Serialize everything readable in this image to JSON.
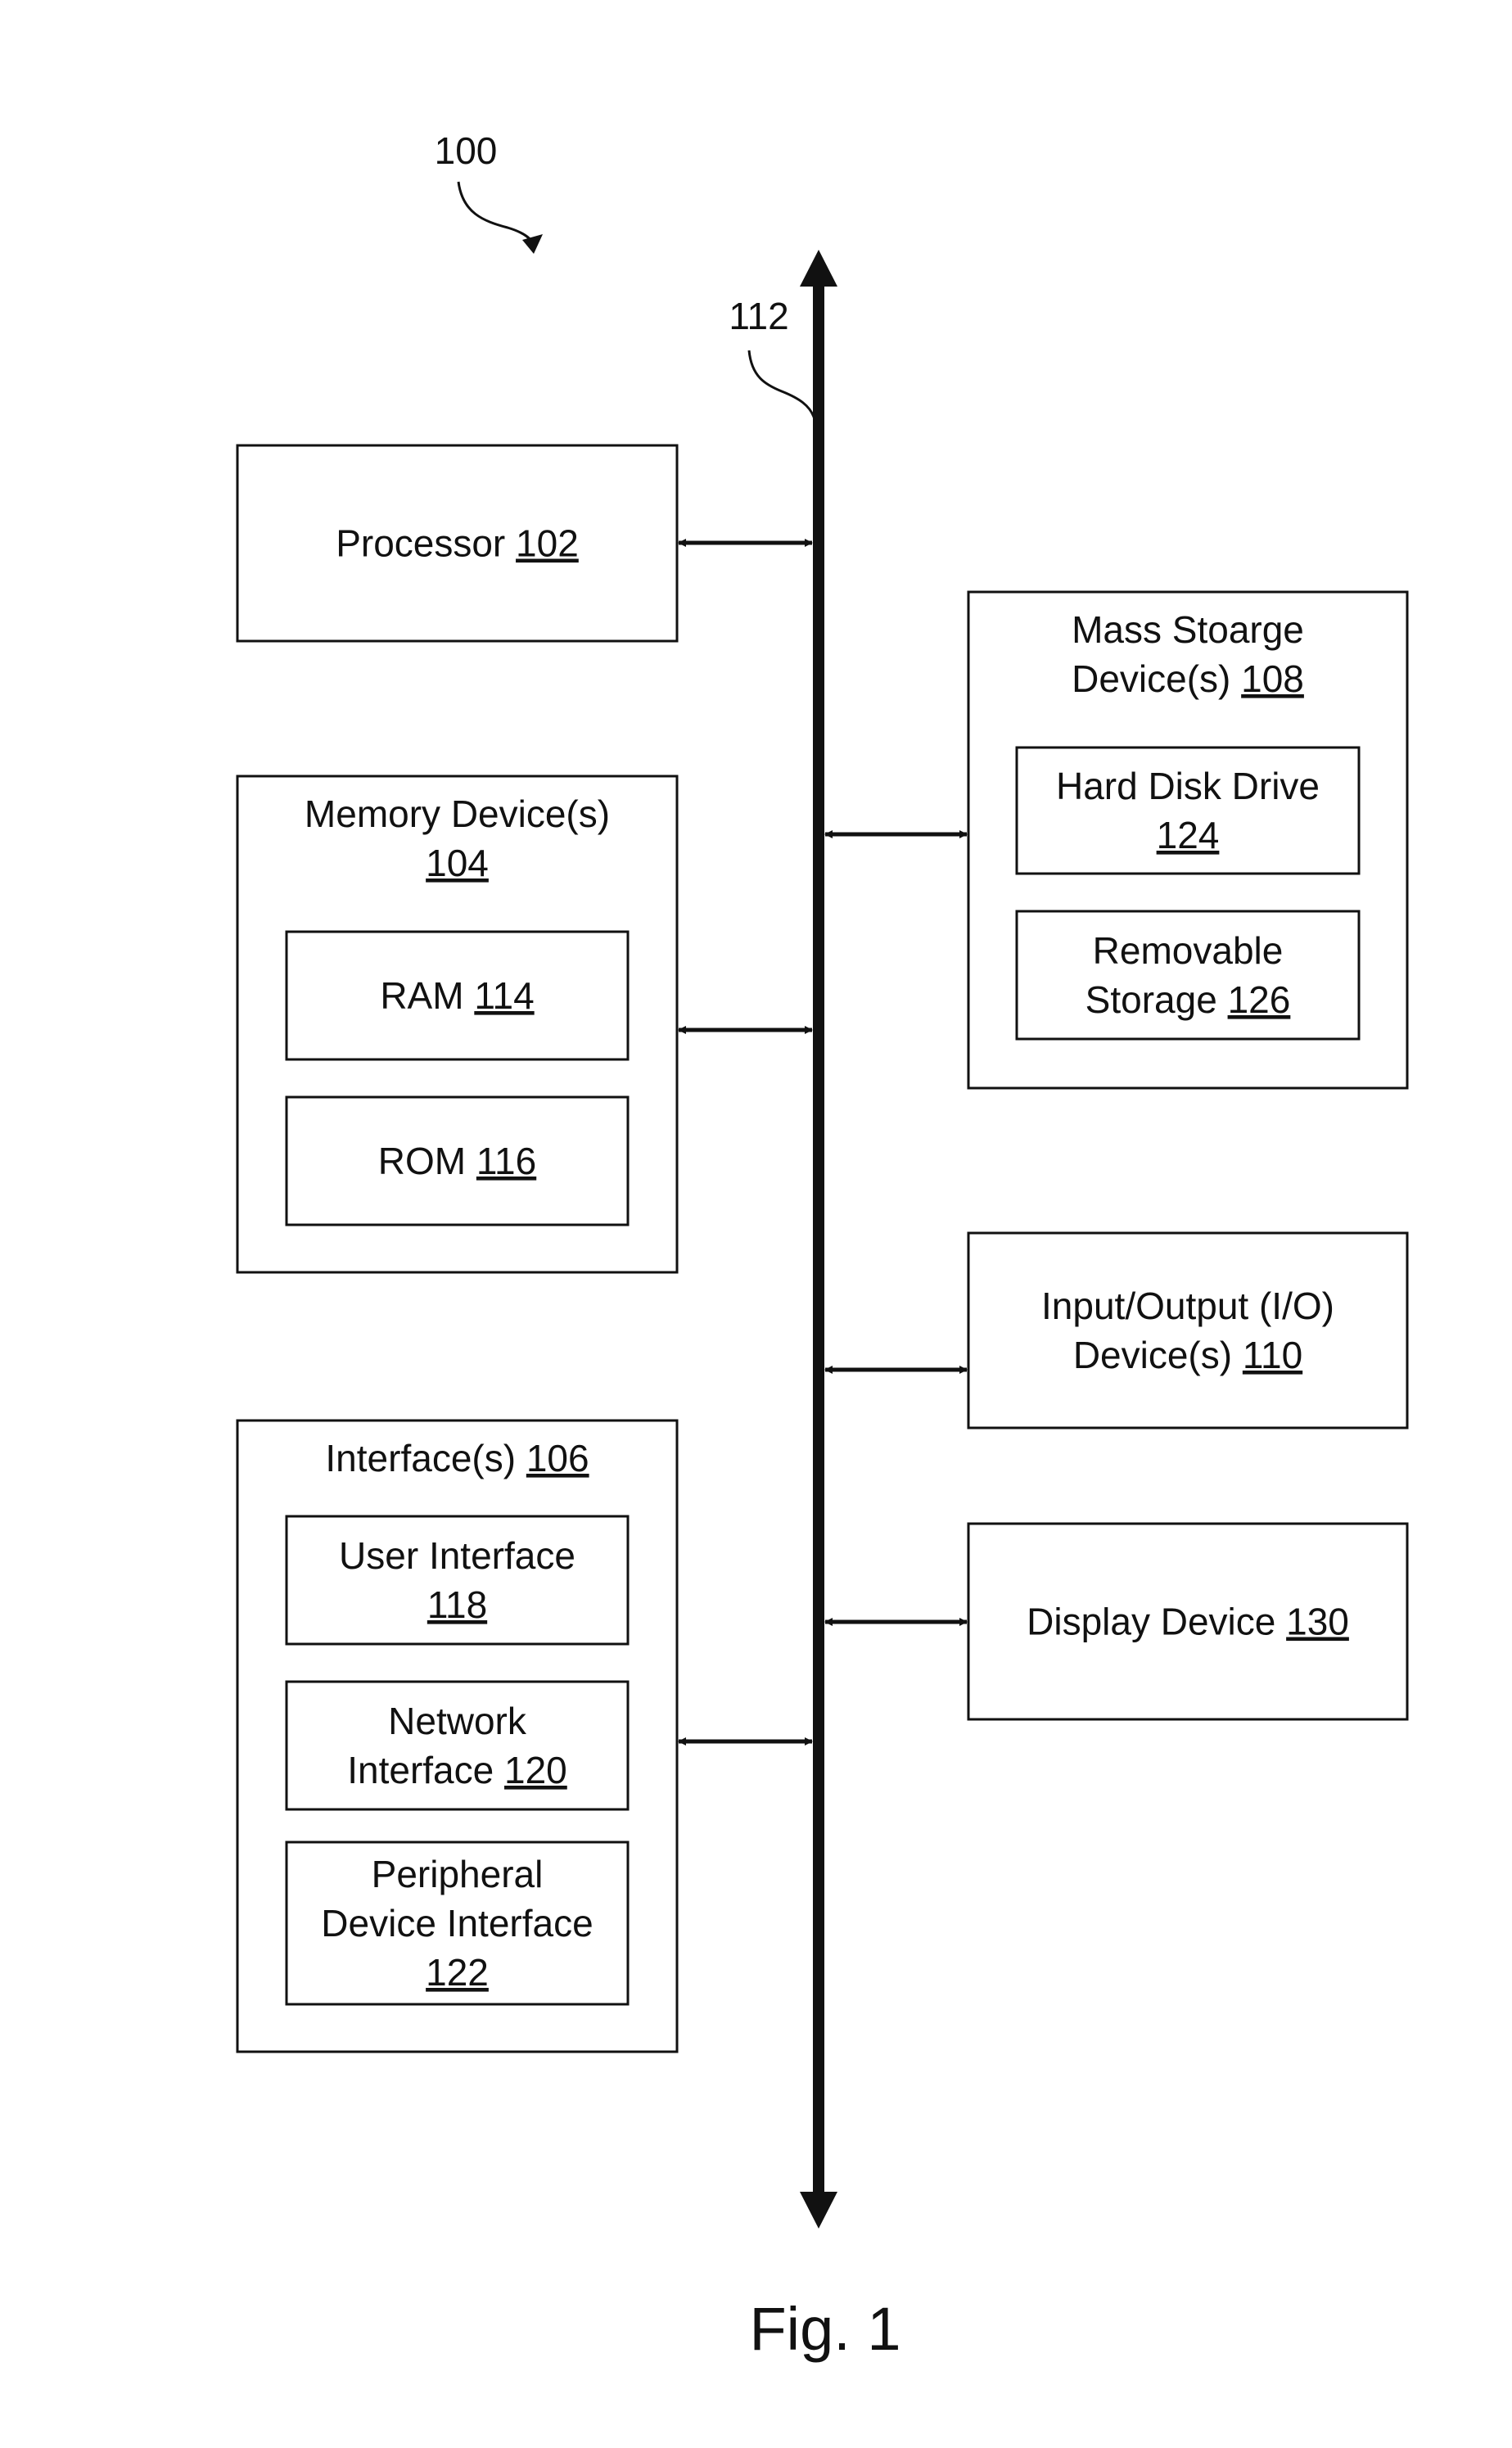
{
  "figure": {
    "system_ref": "100",
    "bus_ref": "112",
    "caption": "Fig. 1"
  },
  "blocks": {
    "processor": {
      "lines": [
        "Processor"
      ],
      "ref": "102"
    },
    "memory": {
      "lines": [
        "Memory Device(s)"
      ],
      "ref": "104",
      "children": {
        "ram": {
          "lines": [
            "RAM"
          ],
          "ref": "114"
        },
        "rom": {
          "lines": [
            "ROM"
          ],
          "ref": "116"
        }
      }
    },
    "interfaces": {
      "lines": [
        "Interface(s)"
      ],
      "ref": "106",
      "children": {
        "user": {
          "lines": [
            "User Interface"
          ],
          "ref": "118"
        },
        "network": {
          "lines": [
            "Network",
            "Interface"
          ],
          "ref": "120"
        },
        "peripheral": {
          "lines": [
            "Peripheral",
            "Device Interface"
          ],
          "ref": "122"
        }
      }
    },
    "mass_storage": {
      "lines": [
        "Mass Stoarge",
        "Device(s)"
      ],
      "ref": "108",
      "children": {
        "hdd": {
          "lines": [
            "Hard Disk Drive"
          ],
          "ref": "124"
        },
        "removable": {
          "lines": [
            "Removable",
            "Storage"
          ],
          "ref": "126"
        }
      }
    },
    "io": {
      "lines": [
        "Input/Output (I/O)",
        "Device(s)"
      ],
      "ref": "110"
    },
    "display": {
      "lines": [
        "Display Device"
      ],
      "ref": "130"
    }
  },
  "connections": [
    "processor-bus",
    "memory-bus",
    "interfaces-bus",
    "mass_storage-bus",
    "io-bus",
    "display-bus"
  ]
}
